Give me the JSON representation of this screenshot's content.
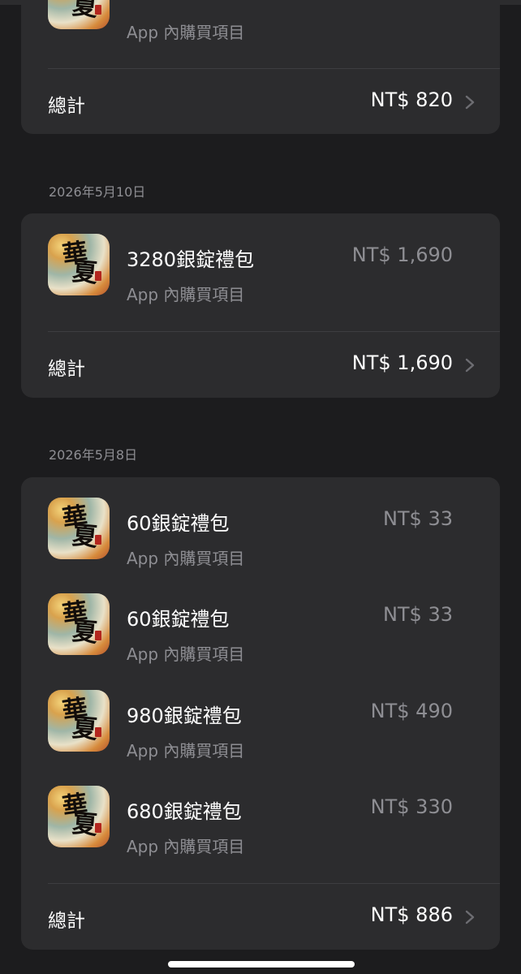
{
  "sections": [
    {
      "date": "",
      "items": [
        {
          "title": "",
          "subtitle": "App 內購買項目",
          "price": ""
        }
      ],
      "total_label": "總計",
      "total_amount": "NT$ 820"
    },
    {
      "date": "2026年5月10日",
      "items": [
        {
          "title": "3280銀錠禮包",
          "subtitle": "App 內購買項目",
          "price": "NT$ 1,690"
        }
      ],
      "total_label": "總計",
      "total_amount": "NT$ 1,690"
    },
    {
      "date": "2026年5月8日",
      "items": [
        {
          "title": "60銀錠禮包",
          "subtitle": "App 內購買項目",
          "price": "NT$ 33"
        },
        {
          "title": "60銀錠禮包",
          "subtitle": "App 內購買項目",
          "price": "NT$ 33"
        },
        {
          "title": "980銀錠禮包",
          "subtitle": "App 內購買項目",
          "price": "NT$ 490"
        },
        {
          "title": "680銀錠禮包",
          "subtitle": "App 內購買項目",
          "price": "NT$ 330"
        }
      ],
      "total_label": "總計",
      "total_amount": "NT$ 886"
    }
  ],
  "icons": {
    "app_icon_glyph_top": "華",
    "app_icon_glyph_bottom": "夏",
    "chevron": "chevron-right-icon"
  },
  "colors": {
    "background": "#1c1c1e",
    "card": "#2c2c2e",
    "secondary_text": "#8e8e93",
    "primary_text": "#ffffff"
  }
}
